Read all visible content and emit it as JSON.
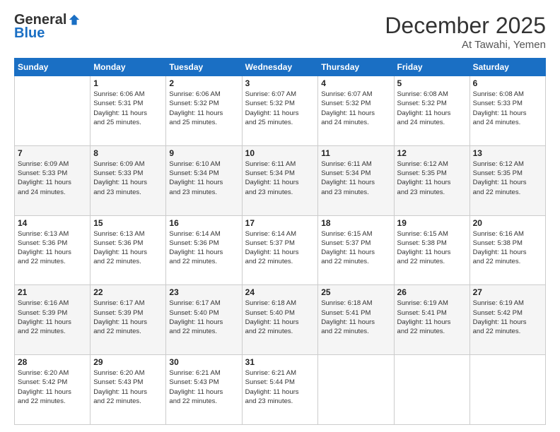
{
  "header": {
    "logo_general": "General",
    "logo_blue": "Blue",
    "month_title": "December 2025",
    "location": "At Tawahi, Yemen"
  },
  "days_of_week": [
    "Sunday",
    "Monday",
    "Tuesday",
    "Wednesday",
    "Thursday",
    "Friday",
    "Saturday"
  ],
  "weeks": [
    [
      {
        "day": "",
        "info": ""
      },
      {
        "day": "1",
        "info": "Sunrise: 6:06 AM\nSunset: 5:31 PM\nDaylight: 11 hours\nand 25 minutes."
      },
      {
        "day": "2",
        "info": "Sunrise: 6:06 AM\nSunset: 5:32 PM\nDaylight: 11 hours\nand 25 minutes."
      },
      {
        "day": "3",
        "info": "Sunrise: 6:07 AM\nSunset: 5:32 PM\nDaylight: 11 hours\nand 25 minutes."
      },
      {
        "day": "4",
        "info": "Sunrise: 6:07 AM\nSunset: 5:32 PM\nDaylight: 11 hours\nand 24 minutes."
      },
      {
        "day": "5",
        "info": "Sunrise: 6:08 AM\nSunset: 5:32 PM\nDaylight: 11 hours\nand 24 minutes."
      },
      {
        "day": "6",
        "info": "Sunrise: 6:08 AM\nSunset: 5:33 PM\nDaylight: 11 hours\nand 24 minutes."
      }
    ],
    [
      {
        "day": "7",
        "info": "Sunrise: 6:09 AM\nSunset: 5:33 PM\nDaylight: 11 hours\nand 24 minutes."
      },
      {
        "day": "8",
        "info": "Sunrise: 6:09 AM\nSunset: 5:33 PM\nDaylight: 11 hours\nand 23 minutes."
      },
      {
        "day": "9",
        "info": "Sunrise: 6:10 AM\nSunset: 5:34 PM\nDaylight: 11 hours\nand 23 minutes."
      },
      {
        "day": "10",
        "info": "Sunrise: 6:11 AM\nSunset: 5:34 PM\nDaylight: 11 hours\nand 23 minutes."
      },
      {
        "day": "11",
        "info": "Sunrise: 6:11 AM\nSunset: 5:34 PM\nDaylight: 11 hours\nand 23 minutes."
      },
      {
        "day": "12",
        "info": "Sunrise: 6:12 AM\nSunset: 5:35 PM\nDaylight: 11 hours\nand 23 minutes."
      },
      {
        "day": "13",
        "info": "Sunrise: 6:12 AM\nSunset: 5:35 PM\nDaylight: 11 hours\nand 22 minutes."
      }
    ],
    [
      {
        "day": "14",
        "info": "Sunrise: 6:13 AM\nSunset: 5:36 PM\nDaylight: 11 hours\nand 22 minutes."
      },
      {
        "day": "15",
        "info": "Sunrise: 6:13 AM\nSunset: 5:36 PM\nDaylight: 11 hours\nand 22 minutes."
      },
      {
        "day": "16",
        "info": "Sunrise: 6:14 AM\nSunset: 5:36 PM\nDaylight: 11 hours\nand 22 minutes."
      },
      {
        "day": "17",
        "info": "Sunrise: 6:14 AM\nSunset: 5:37 PM\nDaylight: 11 hours\nand 22 minutes."
      },
      {
        "day": "18",
        "info": "Sunrise: 6:15 AM\nSunset: 5:37 PM\nDaylight: 11 hours\nand 22 minutes."
      },
      {
        "day": "19",
        "info": "Sunrise: 6:15 AM\nSunset: 5:38 PM\nDaylight: 11 hours\nand 22 minutes."
      },
      {
        "day": "20",
        "info": "Sunrise: 6:16 AM\nSunset: 5:38 PM\nDaylight: 11 hours\nand 22 minutes."
      }
    ],
    [
      {
        "day": "21",
        "info": "Sunrise: 6:16 AM\nSunset: 5:39 PM\nDaylight: 11 hours\nand 22 minutes."
      },
      {
        "day": "22",
        "info": "Sunrise: 6:17 AM\nSunset: 5:39 PM\nDaylight: 11 hours\nand 22 minutes."
      },
      {
        "day": "23",
        "info": "Sunrise: 6:17 AM\nSunset: 5:40 PM\nDaylight: 11 hours\nand 22 minutes."
      },
      {
        "day": "24",
        "info": "Sunrise: 6:18 AM\nSunset: 5:40 PM\nDaylight: 11 hours\nand 22 minutes."
      },
      {
        "day": "25",
        "info": "Sunrise: 6:18 AM\nSunset: 5:41 PM\nDaylight: 11 hours\nand 22 minutes."
      },
      {
        "day": "26",
        "info": "Sunrise: 6:19 AM\nSunset: 5:41 PM\nDaylight: 11 hours\nand 22 minutes."
      },
      {
        "day": "27",
        "info": "Sunrise: 6:19 AM\nSunset: 5:42 PM\nDaylight: 11 hours\nand 22 minutes."
      }
    ],
    [
      {
        "day": "28",
        "info": "Sunrise: 6:20 AM\nSunset: 5:42 PM\nDaylight: 11 hours\nand 22 minutes."
      },
      {
        "day": "29",
        "info": "Sunrise: 6:20 AM\nSunset: 5:43 PM\nDaylight: 11 hours\nand 22 minutes."
      },
      {
        "day": "30",
        "info": "Sunrise: 6:21 AM\nSunset: 5:43 PM\nDaylight: 11 hours\nand 22 minutes."
      },
      {
        "day": "31",
        "info": "Sunrise: 6:21 AM\nSunset: 5:44 PM\nDaylight: 11 hours\nand 23 minutes."
      },
      {
        "day": "",
        "info": ""
      },
      {
        "day": "",
        "info": ""
      },
      {
        "day": "",
        "info": ""
      }
    ]
  ]
}
